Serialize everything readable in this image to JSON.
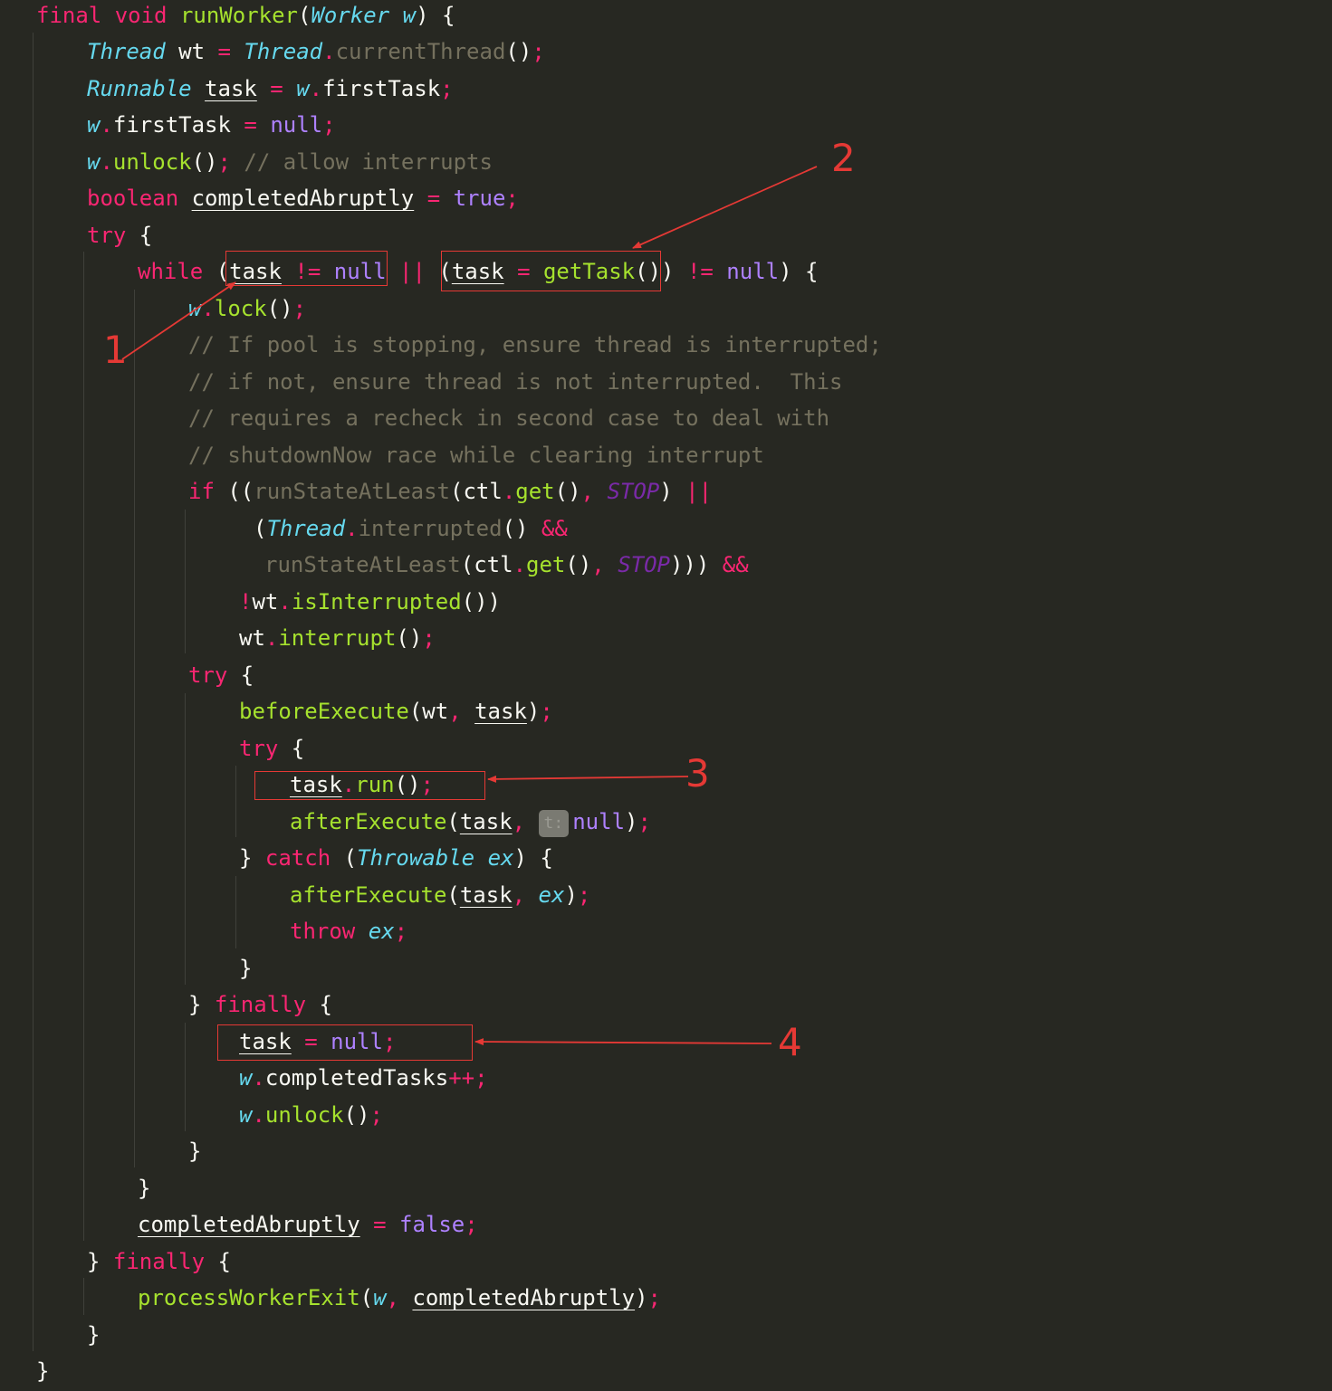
{
  "code": {
    "language": "Java",
    "lines": [
      {
        "tokens": [
          {
            "t": "final",
            "c": "kw"
          },
          {
            "t": " "
          },
          {
            "t": "void",
            "c": "kw"
          },
          {
            "t": " "
          },
          {
            "t": "runWorker",
            "c": "fn"
          },
          {
            "t": "(",
            "c": "br"
          },
          {
            "t": "Worker",
            "c": "typ"
          },
          {
            "t": " "
          },
          {
            "t": "w",
            "c": "prm"
          },
          {
            "t": ") {",
            "c": "br"
          }
        ]
      },
      {
        "tokens": [
          {
            "t": "Thread",
            "c": "typ"
          },
          {
            "t": " wt ",
            "c": "var"
          },
          {
            "t": "=",
            "c": "pun"
          },
          {
            "t": " "
          },
          {
            "t": "Thread",
            "c": "typ"
          },
          {
            "t": ".",
            "c": "pun"
          },
          {
            "t": "currentThread",
            "c": "smth"
          },
          {
            "t": "()",
            "c": "br"
          },
          {
            "t": ";",
            "c": "pun"
          }
        ]
      },
      {
        "tokens": [
          {
            "t": "Runnable",
            "c": "typ"
          },
          {
            "t": " "
          },
          {
            "t": "task",
            "c": "mv"
          },
          {
            "t": " "
          },
          {
            "t": "=",
            "c": "pun"
          },
          {
            "t": " "
          },
          {
            "t": "w",
            "c": "prm"
          },
          {
            "t": ".",
            "c": "pun"
          },
          {
            "t": "firstTask",
            "c": "fld"
          },
          {
            "t": ";",
            "c": "pun"
          }
        ]
      },
      {
        "tokens": [
          {
            "t": "w",
            "c": "prm"
          },
          {
            "t": ".",
            "c": "pun"
          },
          {
            "t": "firstTask",
            "c": "fld"
          },
          {
            "t": " "
          },
          {
            "t": "=",
            "c": "pun"
          },
          {
            "t": " "
          },
          {
            "t": "null",
            "c": "lit"
          },
          {
            "t": ";",
            "c": "pun"
          }
        ]
      },
      {
        "tokens": [
          {
            "t": "w",
            "c": "prm"
          },
          {
            "t": ".",
            "c": "pun"
          },
          {
            "t": "unlock",
            "c": "mth"
          },
          {
            "t": "()",
            "c": "br"
          },
          {
            "t": ";",
            "c": "pun"
          },
          {
            "t": " "
          },
          {
            "t": "// allow interrupts",
            "c": "cmt"
          }
        ]
      },
      {
        "tokens": [
          {
            "t": "boolean",
            "c": "kw"
          },
          {
            "t": " "
          },
          {
            "t": "completedAbruptly",
            "c": "mv"
          },
          {
            "t": " "
          },
          {
            "t": "=",
            "c": "pun"
          },
          {
            "t": " "
          },
          {
            "t": "true",
            "c": "lit"
          },
          {
            "t": ";",
            "c": "pun"
          }
        ]
      },
      {
        "tokens": [
          {
            "t": "try",
            "c": "kw"
          },
          {
            "t": " {",
            "c": "br"
          }
        ]
      },
      {
        "tokens": [
          {
            "t": "while",
            "c": "kw"
          },
          {
            "t": " (",
            "c": "br"
          },
          {
            "t": "task",
            "c": "mv"
          },
          {
            "t": " "
          },
          {
            "t": "!=",
            "c": "pun"
          },
          {
            "t": " "
          },
          {
            "t": "null",
            "c": "lit"
          },
          {
            "t": " "
          },
          {
            "t": "||",
            "c": "pun"
          },
          {
            "t": " (",
            "c": "br"
          },
          {
            "t": "task",
            "c": "mv"
          },
          {
            "t": " "
          },
          {
            "t": "=",
            "c": "pun"
          },
          {
            "t": " "
          },
          {
            "t": "getTask",
            "c": "mth"
          },
          {
            "t": "()) ",
            "c": "br"
          },
          {
            "t": "!=",
            "c": "pun"
          },
          {
            "t": " "
          },
          {
            "t": "null",
            "c": "lit"
          },
          {
            "t": ") {",
            "c": "br"
          }
        ]
      },
      {
        "tokens": [
          {
            "t": "w",
            "c": "prm"
          },
          {
            "t": ".",
            "c": "pun"
          },
          {
            "t": "lock",
            "c": "mth"
          },
          {
            "t": "()",
            "c": "br"
          },
          {
            "t": ";",
            "c": "pun"
          }
        ]
      },
      {
        "tokens": [
          {
            "t": "// If pool is stopping, ensure thread is interrupted;",
            "c": "cmt"
          }
        ]
      },
      {
        "tokens": [
          {
            "t": "// if not, ensure thread is not interrupted.  This",
            "c": "cmt"
          }
        ]
      },
      {
        "tokens": [
          {
            "t": "// requires a recheck in second case to deal with",
            "c": "cmt"
          }
        ]
      },
      {
        "tokens": [
          {
            "t": "// shutdownNow race while clearing interrupt",
            "c": "cmt"
          }
        ]
      },
      {
        "tokens": [
          {
            "t": "if",
            "c": "kw"
          },
          {
            "t": " ((",
            "c": "br"
          },
          {
            "t": "runStateAtLeast",
            "c": "smth"
          },
          {
            "t": "(",
            "c": "br"
          },
          {
            "t": "ctl",
            "c": "fld"
          },
          {
            "t": ".",
            "c": "pun"
          },
          {
            "t": "get",
            "c": "mth"
          },
          {
            "t": "()",
            "c": "br"
          },
          {
            "t": ",",
            "c": "pun"
          },
          {
            "t": " "
          },
          {
            "t": "STOP",
            "c": "cst"
          },
          {
            "t": ") ",
            "c": "br"
          },
          {
            "t": "||",
            "c": "pun"
          }
        ]
      },
      {
        "tokens": [
          {
            "t": "(",
            "c": "br"
          },
          {
            "t": "Thread",
            "c": "typ"
          },
          {
            "t": ".",
            "c": "pun"
          },
          {
            "t": "interrupted",
            "c": "smth"
          },
          {
            "t": "() ",
            "c": "br"
          },
          {
            "t": "&&",
            "c": "pun"
          }
        ]
      },
      {
        "tokens": [
          {
            "t": "runStateAtLeast",
            "c": "smth"
          },
          {
            "t": "(",
            "c": "br"
          },
          {
            "t": "ctl",
            "c": "fld"
          },
          {
            "t": ".",
            "c": "pun"
          },
          {
            "t": "get",
            "c": "mth"
          },
          {
            "t": "()",
            "c": "br"
          },
          {
            "t": ",",
            "c": "pun"
          },
          {
            "t": " "
          },
          {
            "t": "STOP",
            "c": "cst"
          },
          {
            "t": "))) ",
            "c": "br"
          },
          {
            "t": "&&",
            "c": "pun"
          }
        ]
      },
      {
        "tokens": [
          {
            "t": "!",
            "c": "pun"
          },
          {
            "t": "wt",
            "c": "var"
          },
          {
            "t": ".",
            "c": "pun"
          },
          {
            "t": "isInterrupted",
            "c": "mth"
          },
          {
            "t": "())",
            "c": "br"
          }
        ]
      },
      {
        "tokens": [
          {
            "t": "wt",
            "c": "var"
          },
          {
            "t": ".",
            "c": "pun"
          },
          {
            "t": "interrupt",
            "c": "mth"
          },
          {
            "t": "()",
            "c": "br"
          },
          {
            "t": ";",
            "c": "pun"
          }
        ]
      },
      {
        "tokens": [
          {
            "t": "try",
            "c": "kw"
          },
          {
            "t": " {",
            "c": "br"
          }
        ]
      },
      {
        "tokens": [
          {
            "t": "beforeExecute",
            "c": "mth"
          },
          {
            "t": "(",
            "c": "br"
          },
          {
            "t": "wt",
            "c": "var"
          },
          {
            "t": ",",
            "c": "pun"
          },
          {
            "t": " "
          },
          {
            "t": "task",
            "c": "mv"
          },
          {
            "t": ")",
            "c": "br"
          },
          {
            "t": ";",
            "c": "pun"
          }
        ]
      },
      {
        "tokens": [
          {
            "t": "try",
            "c": "kw"
          },
          {
            "t": " {",
            "c": "br"
          }
        ]
      },
      {
        "tokens": [
          {
            "t": "task",
            "c": "mv"
          },
          {
            "t": ".",
            "c": "pun"
          },
          {
            "t": "run",
            "c": "mth"
          },
          {
            "t": "()",
            "c": "br"
          },
          {
            "t": ";",
            "c": "pun"
          }
        ]
      },
      {
        "tokens": [
          {
            "t": "afterExecute",
            "c": "mth"
          },
          {
            "t": "(",
            "c": "br"
          },
          {
            "t": "task",
            "c": "mv"
          },
          {
            "t": ",",
            "c": "pun"
          },
          {
            "t": " "
          },
          {
            "t": "t:",
            "c": "hint"
          },
          {
            "t": "null",
            "c": "lit"
          },
          {
            "t": ")",
            "c": "br"
          },
          {
            "t": ";",
            "c": "pun"
          }
        ]
      },
      {
        "tokens": [
          {
            "t": "} ",
            "c": "br"
          },
          {
            "t": "catch",
            "c": "kw"
          },
          {
            "t": " (",
            "c": "br"
          },
          {
            "t": "Throwable",
            "c": "typ"
          },
          {
            "t": " "
          },
          {
            "t": "ex",
            "c": "prm"
          },
          {
            "t": ") {",
            "c": "br"
          }
        ]
      },
      {
        "tokens": [
          {
            "t": "afterExecute",
            "c": "mth"
          },
          {
            "t": "(",
            "c": "br"
          },
          {
            "t": "task",
            "c": "mv"
          },
          {
            "t": ",",
            "c": "pun"
          },
          {
            "t": " "
          },
          {
            "t": "ex",
            "c": "prm"
          },
          {
            "t": ")",
            "c": "br"
          },
          {
            "t": ";",
            "c": "pun"
          }
        ]
      },
      {
        "tokens": [
          {
            "t": "throw",
            "c": "kw"
          },
          {
            "t": " "
          },
          {
            "t": "ex",
            "c": "prm"
          },
          {
            "t": ";",
            "c": "pun"
          }
        ]
      },
      {
        "tokens": [
          {
            "t": "}",
            "c": "br"
          }
        ]
      },
      {
        "tokens": [
          {
            "t": "} ",
            "c": "br"
          },
          {
            "t": "finally",
            "c": "kw"
          },
          {
            "t": " {",
            "c": "br"
          }
        ]
      },
      {
        "tokens": [
          {
            "t": "task",
            "c": "mv"
          },
          {
            "t": " "
          },
          {
            "t": "=",
            "c": "pun"
          },
          {
            "t": " "
          },
          {
            "t": "null",
            "c": "lit"
          },
          {
            "t": ";",
            "c": "pun"
          }
        ]
      },
      {
        "tokens": [
          {
            "t": "w",
            "c": "prm"
          },
          {
            "t": ".",
            "c": "pun"
          },
          {
            "t": "completedTasks",
            "c": "fld"
          },
          {
            "t": "++;",
            "c": "pun"
          }
        ]
      },
      {
        "tokens": [
          {
            "t": "w",
            "c": "prm"
          },
          {
            "t": ".",
            "c": "pun"
          },
          {
            "t": "unlock",
            "c": "mth"
          },
          {
            "t": "()",
            "c": "br"
          },
          {
            "t": ";",
            "c": "pun"
          }
        ]
      },
      {
        "tokens": [
          {
            "t": "}",
            "c": "br"
          }
        ]
      },
      {
        "tokens": [
          {
            "t": "}",
            "c": "br"
          }
        ]
      },
      {
        "tokens": [
          {
            "t": "completedAbruptly",
            "c": "mv"
          },
          {
            "t": " "
          },
          {
            "t": "=",
            "c": "pun"
          },
          {
            "t": " "
          },
          {
            "t": "false",
            "c": "lit"
          },
          {
            "t": ";",
            "c": "pun"
          }
        ]
      },
      {
        "tokens": [
          {
            "t": "} ",
            "c": "br"
          },
          {
            "t": "finally",
            "c": "kw"
          },
          {
            "t": " {",
            "c": "br"
          }
        ]
      },
      {
        "tokens": [
          {
            "t": "processWorkerExit",
            "c": "mth"
          },
          {
            "t": "(",
            "c": "br"
          },
          {
            "t": "w",
            "c": "prm"
          },
          {
            "t": ",",
            "c": "pun"
          },
          {
            "t": " "
          },
          {
            "t": "completedAbruptly",
            "c": "mv"
          },
          {
            "t": ")",
            "c": "br"
          },
          {
            "t": ";",
            "c": "pun"
          }
        ]
      },
      {
        "tokens": [
          {
            "t": "}",
            "c": "br"
          }
        ]
      },
      {
        "tokens": [
          {
            "t": "}",
            "c": "br"
          }
        ]
      }
    ]
  },
  "annotations": {
    "label_1": "1",
    "label_2": "2",
    "label_3": "3",
    "label_4": "4"
  },
  "colors": {
    "background": "#272822",
    "annotation_red": "#e53935",
    "keyword": "#f92672",
    "type": "#66d9ef",
    "method": "#a6e22e",
    "literal": "#ae81ff",
    "comment": "#75715e"
  }
}
